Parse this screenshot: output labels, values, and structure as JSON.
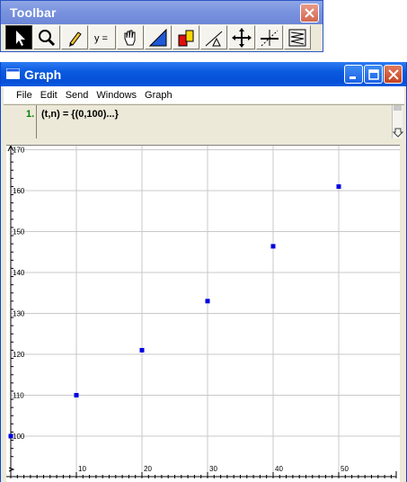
{
  "toolbar": {
    "title": "Toolbar",
    "buttons": [
      {
        "icon": "arrow-pointer-icon"
      },
      {
        "icon": "magnifier-icon"
      },
      {
        "icon": "pencil-icon"
      },
      {
        "icon": "equation-icon",
        "label": "y ="
      },
      {
        "icon": "hand-icon"
      },
      {
        "icon": "triangle-region-icon"
      },
      {
        "icon": "bar-shapes-icon"
      },
      {
        "icon": "slope-tool-icon"
      },
      {
        "icon": "move-arrows-icon"
      },
      {
        "icon": "crosshair-line-icon"
      },
      {
        "icon": "zigzag-icon"
      }
    ]
  },
  "graph_window": {
    "title": "Graph",
    "menu": [
      "File",
      "Edit",
      "Send",
      "Windows",
      "Graph"
    ],
    "entry": {
      "number": "1.",
      "text": "(t,n) = {(0,100)...}"
    }
  },
  "colors": {
    "xp_blue_title": "#0a5ae0",
    "toolbar_title": "#7a93df",
    "window_face": "#ece9d8",
    "point_color": "#0000e0",
    "grid_color": "#c8c8c8"
  },
  "chart_data": {
    "type": "scatter",
    "x": [
      0,
      10,
      20,
      30,
      40,
      50
    ],
    "y": [
      100,
      110,
      121,
      133,
      146.4,
      161
    ],
    "xlim": [
      0,
      60
    ],
    "ylim": [
      95,
      170
    ],
    "xticks": [
      10,
      20,
      30,
      40,
      50
    ],
    "yticks": [
      100,
      110,
      120,
      130,
      140,
      150,
      160,
      170
    ],
    "grid": true,
    "point_color": "#0000e0"
  }
}
